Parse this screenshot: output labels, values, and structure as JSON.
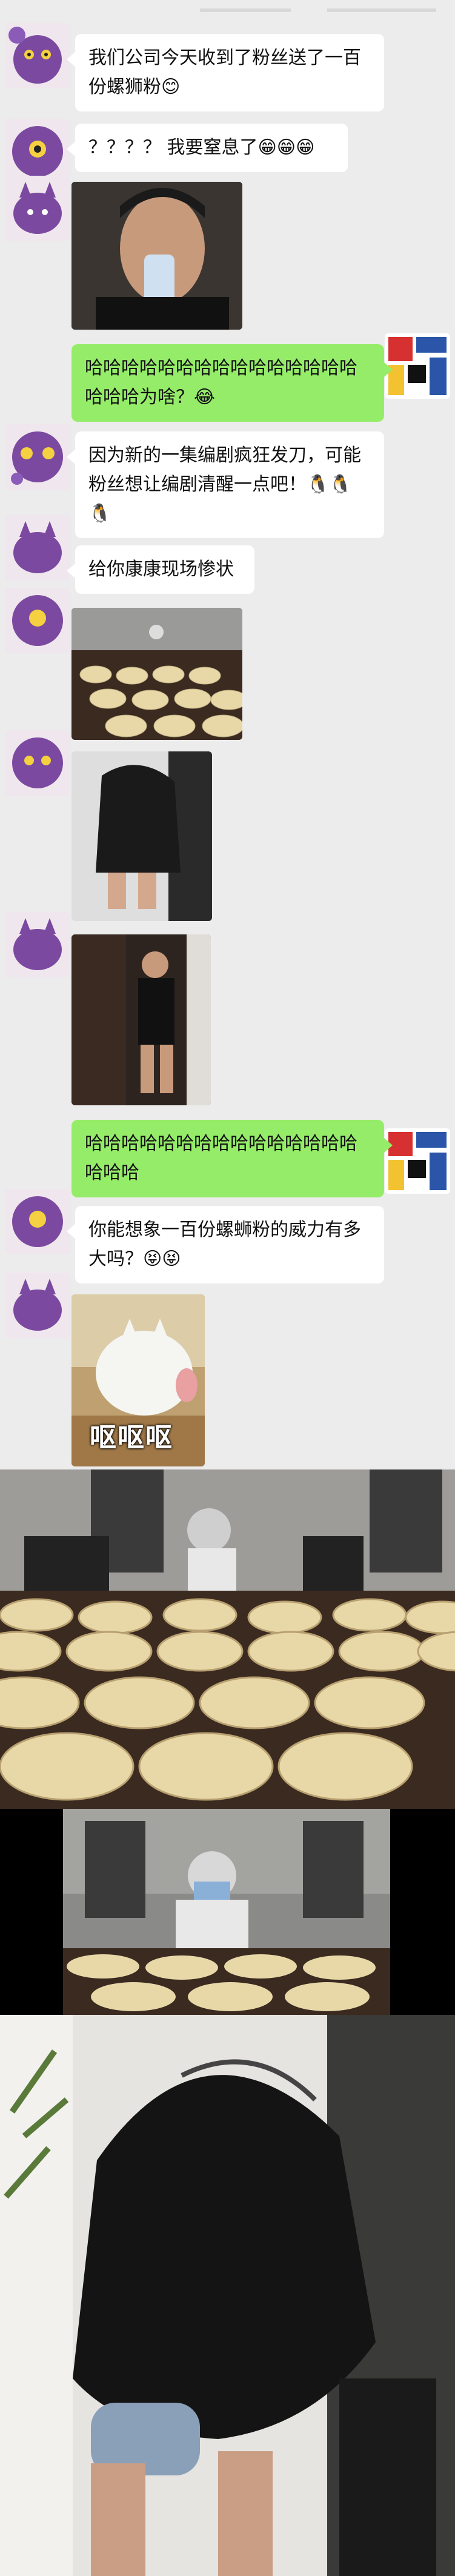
{
  "messages": [
    {
      "side": "left",
      "text": "我们公司今天收到了粉丝送了一百份螺狮粉😊"
    },
    {
      "side": "left",
      "text": "？？？？ 我要窒息了😁😁😁"
    },
    {
      "side": "right",
      "text": "哈哈哈哈哈哈哈哈哈哈哈哈哈哈哈哈哈哈为啥？😂"
    },
    {
      "side": "left",
      "text": "因为新的一集编剧疯狂发刀，可能粉丝想让编剧清醒一点吧！🐧🐧🐧"
    },
    {
      "side": "left",
      "text": "给你康康现场惨状"
    },
    {
      "side": "right",
      "text": "哈哈哈哈哈哈哈哈哈哈哈哈哈哈哈哈哈哈"
    },
    {
      "side": "left",
      "text": "你能想象一百份螺蛳粉的威力有多大吗？😝😝"
    }
  ],
  "sticker_caption": "呕呕呕",
  "icons": {
    "left_avatar": "purple-flower-cat-avatar",
    "right_avatar": "mondrian-avatar"
  },
  "colors": {
    "chat_bg": "#ececec",
    "green_bubble": "#95ec69",
    "white_bubble": "#ffffff"
  }
}
